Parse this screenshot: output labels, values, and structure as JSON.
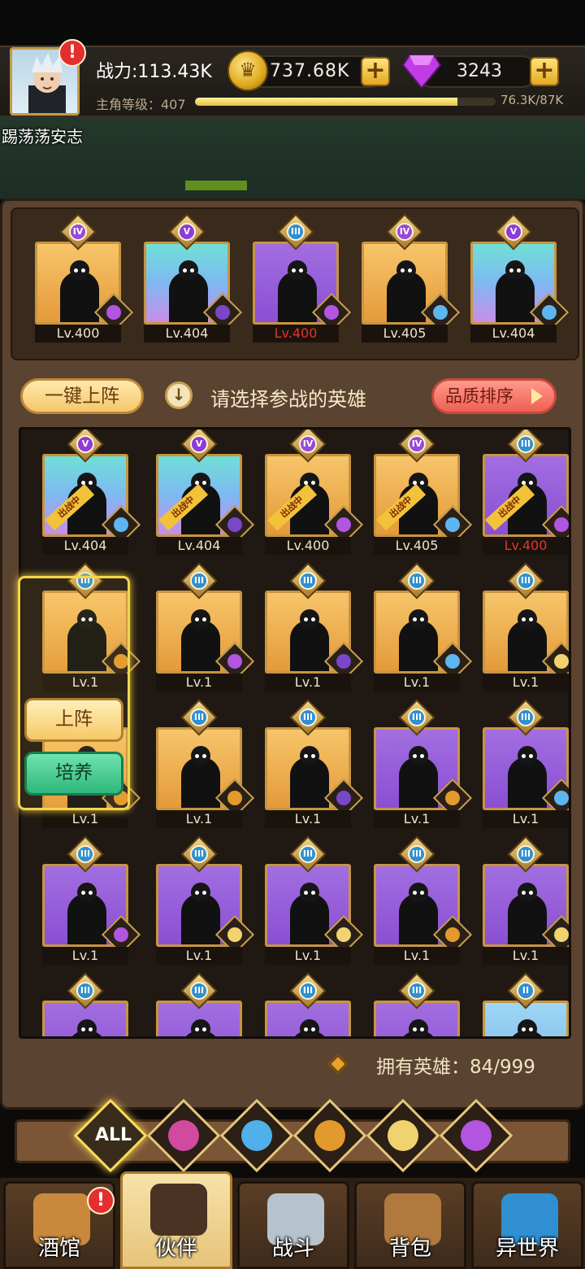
{
  "hud": {
    "power_label": "战力:113.43K",
    "gold": "737.68K",
    "gems": "3243",
    "level_label": "主角等级：407",
    "xp_fraction": 0.874,
    "xp_text": "76.3K/87K",
    "player_name": "踢荡荡安志",
    "plus_symbol": "+",
    "alert_symbol": "!"
  },
  "actions": {
    "one_click": "一键上阵",
    "hint": "请选择参战的英雄",
    "sort": "品质排序"
  },
  "team": [
    {
      "rank": "IV",
      "lv": "Lv.400",
      "bg": "gold",
      "faction": "demon",
      "red": false
    },
    {
      "rank": "V",
      "lv": "Lv.404",
      "bg": "teal",
      "faction": "holy",
      "red": false
    },
    {
      "rank": "III",
      "lv": "Lv.400",
      "bg": "purple",
      "faction": "demon",
      "red": true
    },
    {
      "rank": "IV",
      "lv": "Lv.405",
      "bg": "gold",
      "faction": "elf",
      "red": false
    },
    {
      "rank": "V",
      "lv": "Lv.404",
      "bg": "teal",
      "faction": "elf",
      "red": false
    }
  ],
  "roster_badge": "出战中",
  "roster": [
    {
      "rank": "V",
      "lv": "Lv.404",
      "bg": "teal",
      "faction": "elf",
      "deployed": true,
      "red": false
    },
    {
      "rank": "V",
      "lv": "Lv.404",
      "bg": "teal",
      "faction": "holy",
      "deployed": true,
      "red": false
    },
    {
      "rank": "IV",
      "lv": "Lv.400",
      "bg": "gold",
      "faction": "demon",
      "deployed": true,
      "red": false
    },
    {
      "rank": "IV",
      "lv": "Lv.405",
      "bg": "gold",
      "faction": "elf",
      "deployed": true,
      "red": false
    },
    {
      "rank": "III",
      "lv": "Lv.400",
      "bg": "purple",
      "faction": "demon",
      "deployed": true,
      "red": true
    },
    {
      "rank": "III",
      "lv": "Lv.1",
      "bg": "gold",
      "faction": "lion",
      "deployed": false,
      "red": false
    },
    {
      "rank": "III",
      "lv": "Lv.1",
      "bg": "gold",
      "faction": "demon",
      "deployed": false,
      "red": false
    },
    {
      "rank": "III",
      "lv": "Lv.1",
      "bg": "gold",
      "faction": "holy",
      "deployed": false,
      "red": false
    },
    {
      "rank": "III",
      "lv": "Lv.1",
      "bg": "gold",
      "faction": "elf",
      "deployed": false,
      "red": false
    },
    {
      "rank": "III",
      "lv": "Lv.1",
      "bg": "gold",
      "faction": "fairy",
      "deployed": false,
      "red": false
    },
    {
      "rank": "III",
      "lv": "Lv.1",
      "bg": "gold",
      "faction": "lion",
      "deployed": false,
      "red": false
    },
    {
      "rank": "III",
      "lv": "Lv.1",
      "bg": "gold",
      "faction": "lion",
      "deployed": false,
      "red": false
    },
    {
      "rank": "III",
      "lv": "Lv.1",
      "bg": "gold",
      "faction": "holy",
      "deployed": false,
      "red": false
    },
    {
      "rank": "III",
      "lv": "Lv.1",
      "bg": "purple",
      "faction": "lion",
      "deployed": false,
      "red": false
    },
    {
      "rank": "III",
      "lv": "Lv.1",
      "bg": "purple",
      "faction": "elf",
      "deployed": false,
      "red": false
    },
    {
      "rank": "III",
      "lv": "Lv.1",
      "bg": "purple",
      "faction": "demon",
      "deployed": false,
      "red": false
    },
    {
      "rank": "III",
      "lv": "Lv.1",
      "bg": "purple",
      "faction": "fairy",
      "deployed": false,
      "red": false
    },
    {
      "rank": "III",
      "lv": "Lv.1",
      "bg": "purple",
      "faction": "fairy",
      "deployed": false,
      "red": false
    },
    {
      "rank": "III",
      "lv": "Lv.1",
      "bg": "purple",
      "faction": "lion",
      "deployed": false,
      "red": false
    },
    {
      "rank": "III",
      "lv": "Lv.1",
      "bg": "purple",
      "faction": "fairy",
      "deployed": false,
      "red": false
    },
    {
      "rank": "III",
      "lv": "",
      "bg": "purple",
      "faction": "",
      "deployed": false,
      "red": false
    },
    {
      "rank": "III",
      "lv": "",
      "bg": "purple",
      "faction": "",
      "deployed": false,
      "red": false
    },
    {
      "rank": "III",
      "lv": "",
      "bg": "purple",
      "faction": "",
      "deployed": false,
      "red": false
    },
    {
      "rank": "III",
      "lv": "",
      "bg": "purple",
      "faction": "",
      "deployed": false,
      "red": false
    },
    {
      "rank": "II",
      "lv": "",
      "bg": "blue",
      "faction": "",
      "deployed": false,
      "red": false
    }
  ],
  "popup": {
    "deploy": "上阵",
    "train": "培养"
  },
  "owned": "拥有英雄：84/999",
  "filters": [
    {
      "name": "all",
      "label": "ALL"
    },
    {
      "name": "holy-icon",
      "color": "#d14aa0"
    },
    {
      "name": "elf-icon",
      "color": "#4fb0ea"
    },
    {
      "name": "lion-icon",
      "color": "#e39a2d"
    },
    {
      "name": "fairy-icon",
      "color": "#f0d36e"
    },
    {
      "name": "demon-icon",
      "color": "#b255e0"
    }
  ],
  "nav": [
    {
      "label": "酒馆",
      "icon": "tavern-icon",
      "color": "#c9893c",
      "alert": true
    },
    {
      "label": "伙伴",
      "icon": "partner-icon",
      "color": "#4a3322",
      "active": true
    },
    {
      "label": "战斗",
      "icon": "battle-icon",
      "color": "#b7c3cc"
    },
    {
      "label": "背包",
      "icon": "backpack-icon",
      "color": "#b07a3e"
    },
    {
      "label": "异世界",
      "icon": "portal-icon",
      "color": "#2f8fd1"
    }
  ],
  "colors": {
    "accent_gold": "#e3a922",
    "gem": "#c13be6",
    "deploy_green": "#2fb77a"
  }
}
